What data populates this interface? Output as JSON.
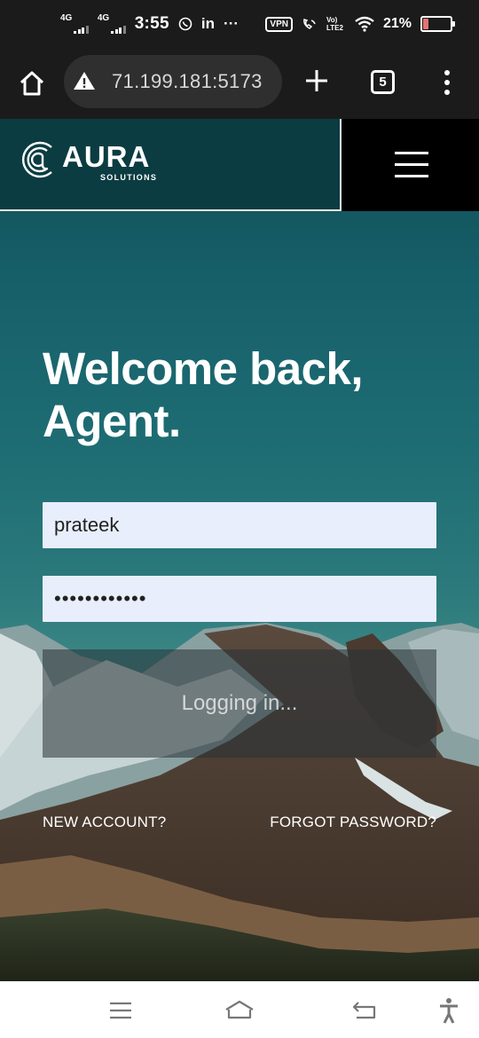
{
  "status_bar": {
    "network_1": "4G",
    "network_2": "4G",
    "time": "3:55",
    "linkedin": "in",
    "more": "···",
    "vpn": "VPN",
    "volte": "Vo) LTE2",
    "battery_percent": "21%",
    "battery_level": 0.21
  },
  "browser": {
    "url": "71.199.181:5173",
    "tab_count": "5",
    "icons": [
      "home-icon",
      "warning-icon",
      "plus-icon",
      "tabs-icon",
      "more-vert-icon"
    ]
  },
  "site": {
    "logo_name": "AURA",
    "logo_sub": "SOLUTIONS",
    "menu_icon": "hamburger-icon"
  },
  "login": {
    "welcome_line1": "Welcome back,",
    "welcome_line2": "Agent.",
    "username_value": "prateek",
    "password_value": "••••••••••••",
    "button_label": "Logging in...",
    "new_account": "NEW ACCOUNT?",
    "forgot_password": "FORGOT PASSWORD?"
  },
  "nav_bar": {
    "icons": [
      "recents-icon",
      "home-icon",
      "back-icon",
      "accessibility-icon"
    ]
  }
}
